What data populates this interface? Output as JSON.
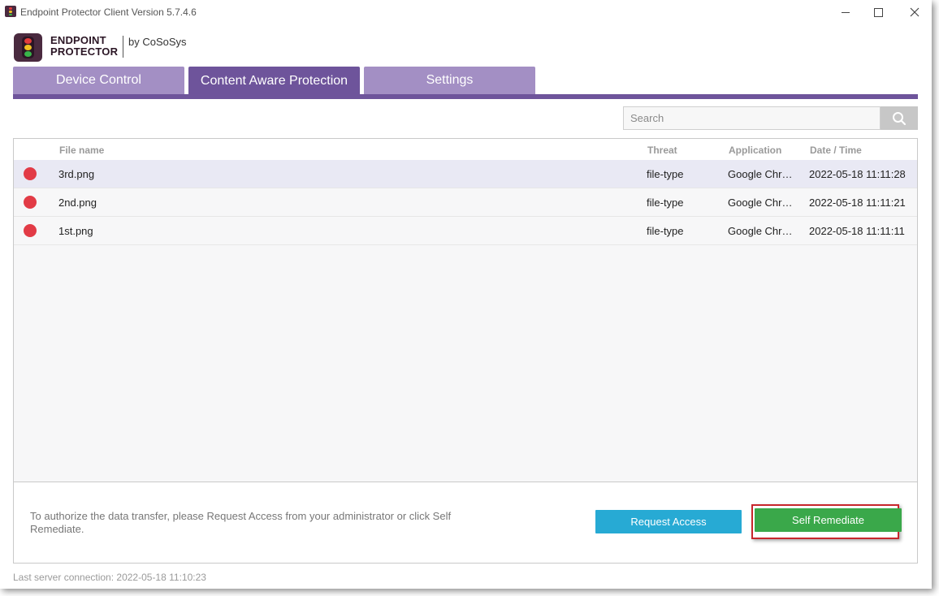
{
  "window": {
    "title": "Endpoint Protector Client Version 5.7.4.6"
  },
  "logo": {
    "line1": "ENDPOINT",
    "line2": "PROTECTOR",
    "by": "by CoSoSys"
  },
  "tabs": [
    {
      "label": "Device Control",
      "active": false
    },
    {
      "label": "Content Aware Protection",
      "active": true
    },
    {
      "label": "Settings",
      "active": false
    }
  ],
  "search": {
    "placeholder": "Search",
    "icon": "search-icon"
  },
  "table": {
    "columns": {
      "file": "File name",
      "threat": "Threat",
      "application": "Application",
      "datetime": "Date / Time"
    },
    "rows": [
      {
        "file": "3rd.png",
        "threat": "file-type",
        "application": "Google Chr…",
        "datetime": "2022-05-18 11:11:28",
        "status_color": "#e23b46"
      },
      {
        "file": "2nd.png",
        "threat": "file-type",
        "application": "Google Chr…",
        "datetime": "2022-05-18 11:11:21",
        "status_color": "#e23b46"
      },
      {
        "file": "1st.png",
        "threat": "file-type",
        "application": "Google Chr…",
        "datetime": "2022-05-18 11:11:11",
        "status_color": "#e23b46"
      }
    ]
  },
  "actions": {
    "hint": "To authorize the data transfer, please Request Access from your administrator or click Self Remediate.",
    "request_label": "Request Access",
    "remediate_label": "Self Remediate"
  },
  "status": {
    "last_connection": "Last server connection: 2022-05-18 11:10:23"
  },
  "colors": {
    "brand_purple": "#6e549b",
    "tab_inactive": "#a38fc4",
    "request_blue": "#27aad4",
    "remediate_green": "#3aa84a",
    "threat_red": "#e23b46"
  }
}
